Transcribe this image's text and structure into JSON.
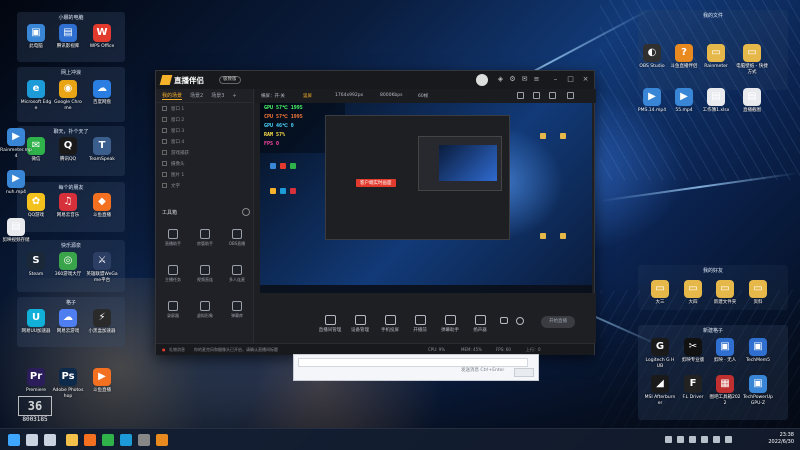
{
  "desktop": {
    "groups": [
      {
        "title": "小娜的电脑"
      },
      {
        "title": "网上冲浪"
      },
      {
        "title": "聊天，扑个天了"
      },
      {
        "title": "每个的朋友"
      },
      {
        "title": "快乐源泉"
      },
      {
        "title": "格子"
      },
      {
        "title": "我的文件"
      },
      {
        "title": "我的好友"
      },
      {
        "title": "新建格子"
      }
    ],
    "icons": [
      {
        "label": "此电脑",
        "glyph": "▣",
        "color": "#3a86d6"
      },
      {
        "label": "腾讯影视库",
        "glyph": "▤",
        "color": "#2f6fd0"
      },
      {
        "label": "WPS Office",
        "glyph": "W",
        "color": "#e23b2e"
      },
      {
        "label": "Microsoft Edge",
        "glyph": "e",
        "color": "#1d9bd9"
      },
      {
        "label": "Google Chrome",
        "glyph": "◉",
        "color": "#e8a415"
      },
      {
        "label": "百度网盘",
        "glyph": "☁",
        "color": "#2a7de1"
      },
      {
        "label": "微信",
        "glyph": "✉",
        "color": "#2fb24a"
      },
      {
        "label": "腾讯QQ",
        "glyph": "Q",
        "color": "#1a1a1a"
      },
      {
        "label": "TeamSpeak",
        "glyph": "T",
        "color": "#3b5e8c"
      },
      {
        "label": "QQ游戏",
        "glyph": "✿",
        "color": "#f4c21c"
      },
      {
        "label": "网易云音乐",
        "glyph": "♫",
        "color": "#d6303a"
      },
      {
        "label": "斗鱼直播",
        "glyph": "◆",
        "color": "#f37021"
      },
      {
        "label": "Steam",
        "glyph": "S",
        "color": "#1b2838"
      },
      {
        "label": "360游戏大厅",
        "glyph": "◎",
        "color": "#3aa44a"
      },
      {
        "label": "英雄联盟WeGame平台",
        "glyph": "⚔",
        "color": "#2c3e64"
      },
      {
        "label": "网易UU加速器",
        "glyph": "U",
        "color": "#10b0d8"
      },
      {
        "label": "网易云游戏",
        "glyph": "☁",
        "color": "#4f7ef0"
      },
      {
        "label": "小黑盒加速器",
        "glyph": "⚡",
        "color": "#2a2a2a"
      },
      {
        "label": "Premiere",
        "glyph": "Pr",
        "color": "#2a1d5a"
      },
      {
        "label": "Adobe Photoshop",
        "glyph": "Ps",
        "color": "#0e2a4a"
      },
      {
        "label": "斗鱼直播",
        "glyph": "▶",
        "color": "#f37021"
      },
      {
        "label": "OBS Studio",
        "glyph": "◐",
        "color": "#303030"
      },
      {
        "label": "斗鱼直播伴侣",
        "glyph": "?",
        "color": "#e88a20"
      },
      {
        "label": "Rainmeter",
        "glyph": "▭",
        "color": "#e6b84a"
      },
      {
        "label": "电脑壁纸 - 快捷方式",
        "glyph": "▭",
        "color": "#e6b84a"
      },
      {
        "label": "PMS.14.mp4",
        "glyph": "▶",
        "color": "#3a86d6"
      },
      {
        "label": "55.mp4",
        "glyph": "▶",
        "color": "#3a86d6"
      },
      {
        "label": "工作簿1.xlsx",
        "glyph": "▤",
        "color": "#e8eaee"
      },
      {
        "label": "直播截图",
        "glyph": "▤",
        "color": "#e8eaee"
      },
      {
        "label": "大三",
        "glyph": "▭",
        "color": "#e6b84a"
      },
      {
        "label": "大四",
        "glyph": "▭",
        "color": "#e6b84a"
      },
      {
        "label": "新建文件夹",
        "glyph": "▭",
        "color": "#e6b84a"
      },
      {
        "label": "资料",
        "glyph": "▭",
        "color": "#e6b84a"
      },
      {
        "label": "Logitech G HUB",
        "glyph": "G",
        "color": "#1a1a1a"
      },
      {
        "label": "剪映专业版",
        "glyph": "✂",
        "color": "#111111"
      },
      {
        "label": "剪映 · 无人",
        "glyph": "▣",
        "color": "#2f6fd0"
      },
      {
        "label": "TechMem5",
        "glyph": "▣",
        "color": "#2f6fd0"
      },
      {
        "label": "MSI Afterburner",
        "glyph": "◢",
        "color": "#1a1a1a"
      },
      {
        "label": "F.L Driver",
        "glyph": "F",
        "color": "#222222"
      },
      {
        "label": "图吧工具箱2022",
        "glyph": "▦",
        "color": "#c03030"
      },
      {
        "label": "TechPowerUp GPU-Z",
        "glyph": "▣",
        "color": "#3a86d6"
      },
      {
        "label": "Rainmeter.mp4",
        "glyph": "▶",
        "color": "#3a86d6"
      },
      {
        "label": "nuh.mp4",
        "glyph": "▶",
        "color": "#3a86d6"
      },
      {
        "label": "剪映视频存储",
        "glyph": "▤",
        "color": "#e8eaee"
      }
    ]
  },
  "app": {
    "name": "直播伴侣",
    "version": "极致版",
    "left_tabs": [
      "我的场景",
      "场景2",
      "场景3"
    ],
    "sources": [
      "窗口 1",
      "窗口 2",
      "窗口 3",
      "窗口 4",
      "游戏捕获",
      "摄像头",
      "图片 1",
      "文字"
    ],
    "tools_title": "工具箱",
    "tools": [
      "直播助手",
      "房管助手",
      "OBS直播",
      "主播任务",
      "视频直连",
      "多人连麦",
      "录屏器",
      "虚拟形象",
      "弹幕库"
    ],
    "preview_bar": {
      "mode": "横屏：开·关",
      "btn": "竖屏",
      "resolution": "1764x992px",
      "bitrate": "8000Kbps",
      "fps": "60帧"
    },
    "overlay": {
      "lines": [
        {
          "label": "GPU",
          "value": "57",
          "unit": "℃",
          "extra": "1995",
          "color": "#4bff6a"
        },
        {
          "label": "CPU",
          "value": "57",
          "unit": "℃",
          "extra": "1995",
          "color": "#ff7a3a"
        },
        {
          "label": "GPU",
          "value": "46",
          "unit": "℃",
          "extra": "0",
          "color": "#4bd8ff"
        },
        {
          "label": "RAM",
          "value": "57",
          "unit": "%",
          "extra": "",
          "color": "#ffe24a"
        },
        {
          "label": "FPS",
          "value": "0",
          "unit": "",
          "extra": "",
          "color": "#ff4aa8"
        }
      ]
    },
    "preview_badge": "客户端实时画面",
    "controls": [
      "直播间管理",
      "设备管理",
      "手机投屏",
      "开播前",
      "弹幕助手",
      "扬声器"
    ],
    "start_label": "开始直播",
    "status": {
      "left": "礼物消息",
      "mid": "你的麦克风和摄像头已开启，请确认直播间标题",
      "right1": "CPU: 9%",
      "right2": "MEM: 45%",
      "right3": "FPS: 60",
      "right4": "上行：0"
    }
  },
  "chat": {
    "placeholder": "发送消息 Ctrl+Enter"
  },
  "watermark": {
    "logo": "36",
    "number": "8003185"
  },
  "taskbar": {
    "icons": [
      {
        "name": "windows",
        "color": "#3ea6ff"
      },
      {
        "name": "search",
        "color": "#c9d2e0"
      },
      {
        "name": "task-view",
        "color": "#c9d2e0"
      },
      {
        "name": "file-explorer",
        "color": "#f2c14b"
      },
      {
        "name": "douyu",
        "color": "#f37021"
      },
      {
        "name": "wechat",
        "color": "#2fb24a"
      },
      {
        "name": "edge",
        "color": "#1d9bd9"
      },
      {
        "name": "obs",
        "color": "#888888"
      },
      {
        "name": "streamer",
        "color": "#e88a20"
      }
    ],
    "time": "23:38",
    "date": "2022/6/30"
  }
}
